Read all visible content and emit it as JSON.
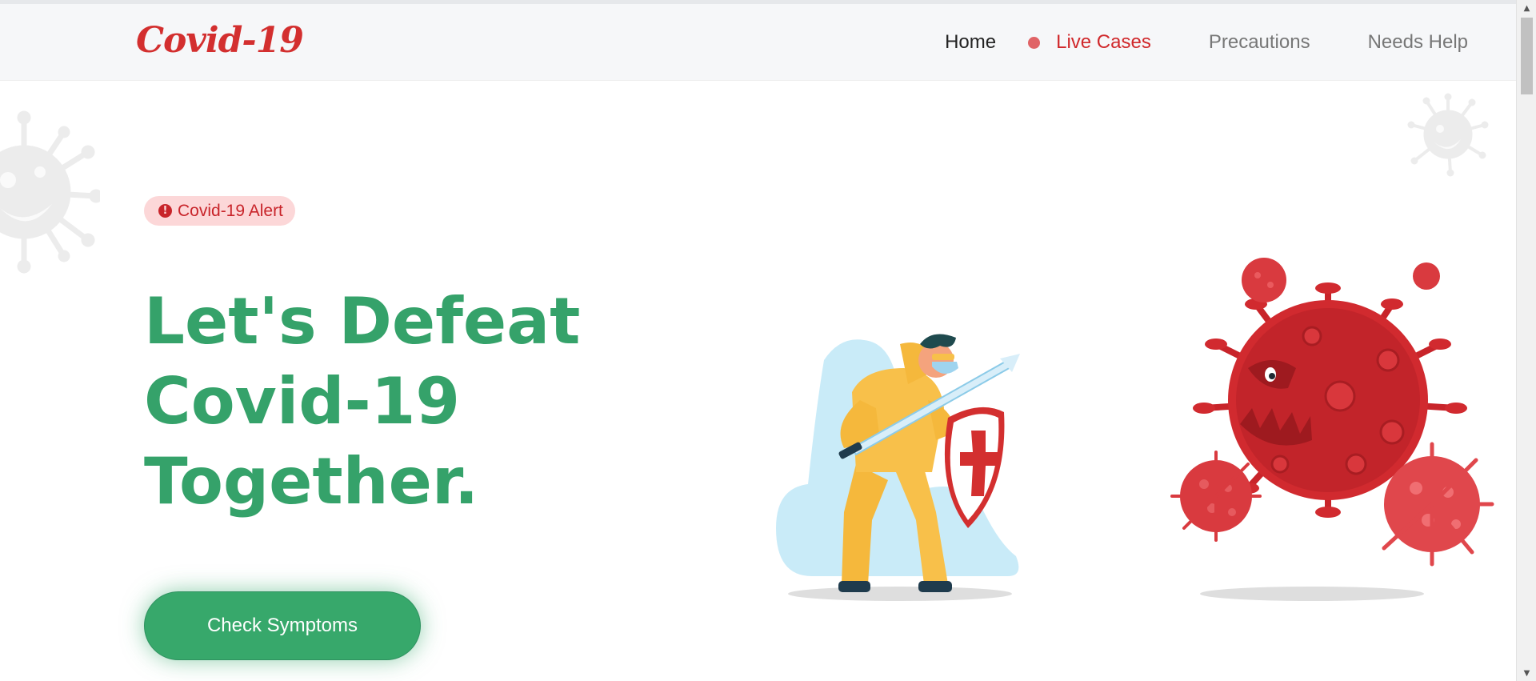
{
  "brand": {
    "logo": "Covid-19",
    "logo_color": "#d32f2f"
  },
  "nav": {
    "home": "Home",
    "live_cases": "Live Cases",
    "precautions": "Precautions",
    "needs_help": "Needs Help",
    "live_dot_color": "#e06366",
    "active_color": "#d0282b"
  },
  "hero": {
    "alert_label": "Covid-19 Alert",
    "alert_icon": "exclamation-circle-icon",
    "headline_line1": "Let's Defeat",
    "headline_line2": "Covid-19",
    "headline_line3": "Together.",
    "headline_color": "#35a26a",
    "cta_label": "Check Symptoms",
    "cta_color": "#37a86b"
  },
  "illustration": {
    "hero": "hazmat-fighter-with-sword-and-shield",
    "villain": "angry-red-virus",
    "virus_color": "#d12a2f",
    "suit_color": "#f8c04a",
    "decorations": [
      "faded-virus-icon-left",
      "faded-virus-icon-right"
    ]
  }
}
